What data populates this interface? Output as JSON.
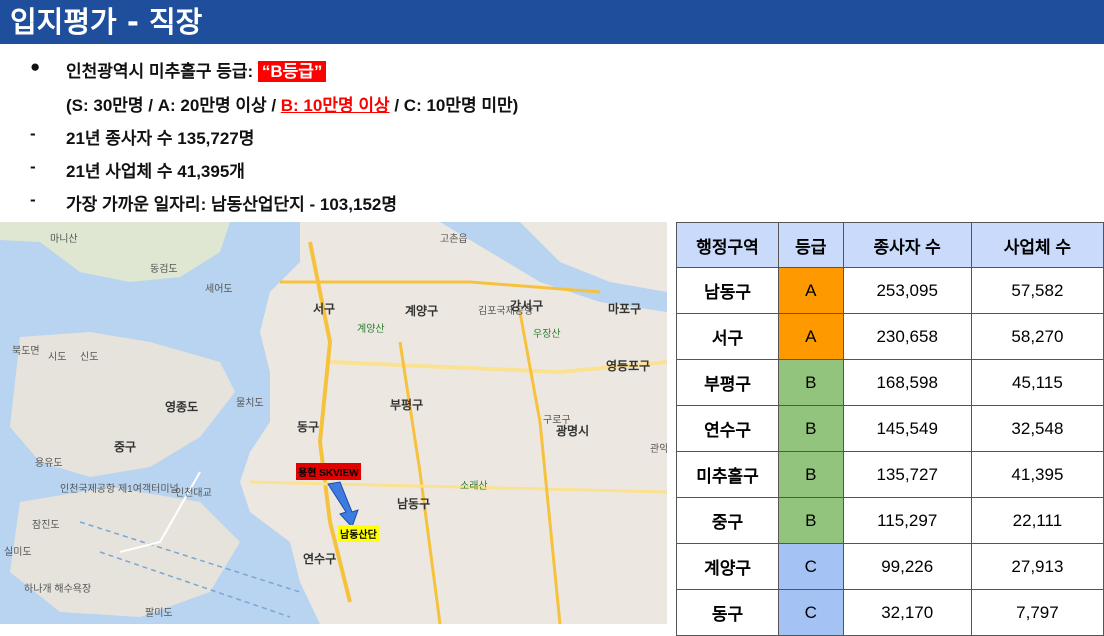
{
  "title": "입지평가 - 직장",
  "bullets": {
    "main_prefix": "인천광역시 미추홀구 등급: ",
    "main_grade": "“B등급”",
    "criteria_open": "(S: 30만명 / A: 20만명 이상 / ",
    "criteria_b": "B: 10만명 이상",
    "criteria_close": " / C: 10만명 미만)",
    "items": [
      "21년 종사자 수 135,727명",
      "21년 사업체 수 41,395개",
      "가장 가까운 일자리: 남동산업단지 - 103,152명"
    ]
  },
  "map": {
    "labels": [
      "마니산",
      "동검도",
      "세어도",
      "서구",
      "계양구",
      "김포국제공항",
      "강서구",
      "마포구",
      "영등포구",
      "북도면",
      "시도",
      "신도",
      "영종도",
      "물치도",
      "중구",
      "용유도",
      "인천국제공항 제1여객터미널",
      "잠진도",
      "실미도",
      "하나개 해수욕장",
      "동구",
      "부평구",
      "구로구",
      "광명시",
      "남동구",
      "연수구",
      "팔미도",
      "소래산",
      "계양산",
      "우장산",
      "인천대교",
      "고촌읍",
      "관악"
    ],
    "marker_home": "용현 SKVIEW",
    "marker_work": "남동산단"
  },
  "table": {
    "headers": [
      "행정구역",
      "등급",
      "종사자 수",
      "사업체 수"
    ],
    "rows": [
      {
        "region": "남동구",
        "grade": "A",
        "workers": "253,095",
        "firms": "57,582"
      },
      {
        "region": "서구",
        "grade": "A",
        "workers": "230,658",
        "firms": "58,270"
      },
      {
        "region": "부평구",
        "grade": "B",
        "workers": "168,598",
        "firms": "45,115"
      },
      {
        "region": "연수구",
        "grade": "B",
        "workers": "145,549",
        "firms": "32,548"
      },
      {
        "region": "미추홀구",
        "grade": "B",
        "workers": "135,727",
        "firms": "41,395"
      },
      {
        "region": "중구",
        "grade": "B",
        "workers": "115,297",
        "firms": "22,111"
      },
      {
        "region": "계양구",
        "grade": "C",
        "workers": "99,226",
        "firms": "27,913"
      },
      {
        "region": "동구",
        "grade": "C",
        "workers": "32,170",
        "firms": "7,797"
      }
    ],
    "grade_colors": {
      "A": "#ff9900",
      "B": "#93c47d",
      "C": "#a4c2f4"
    }
  }
}
